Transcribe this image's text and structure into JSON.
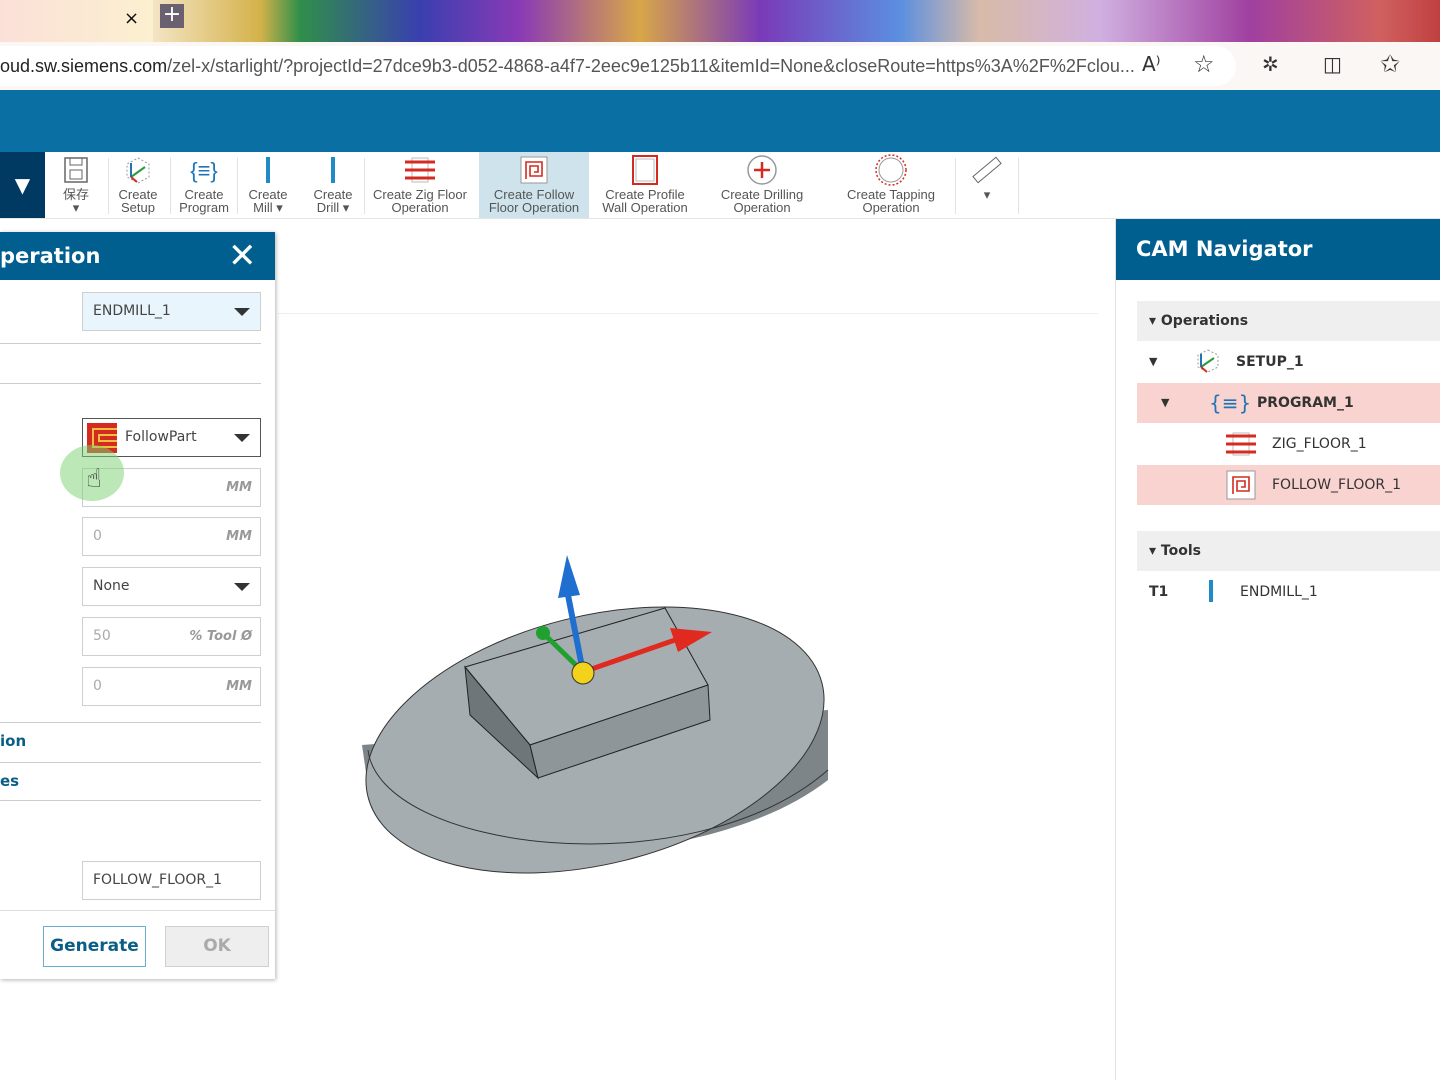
{
  "browser": {
    "tab_close": "×",
    "new_tab": "+",
    "url_domain": "oud.sw.siemens.com",
    "url_rest": "/zel-x/starlight/?projectId=27dce9b3-d052-4868-a4f7-2eec9e125b11&itemId=None&closeRoute=https%3A%2F%2Fclou...",
    "read_aloud": "A⁾",
    "favorite": "☆",
    "extensions": "✲",
    "split": "◫",
    "favorites": "✩"
  },
  "toolbar": {
    "save": "保存",
    "items": [
      {
        "label1": "Create",
        "label2": "Setup"
      },
      {
        "label1": "Create",
        "label2": "Program"
      },
      {
        "label1": "Create",
        "label2": "Mill ▾"
      },
      {
        "label1": "Create",
        "label2": "Drill ▾"
      },
      {
        "label1": "Create Zig Floor",
        "label2": "Operation"
      },
      {
        "label1": "Create Follow",
        "label2": "Floor Operation"
      },
      {
        "label1": "Create Profile",
        "label2": "Wall Operation"
      },
      {
        "label1": "Create Drilling",
        "label2": "Operation"
      },
      {
        "label1": "Create Tapping",
        "label2": "Operation"
      }
    ],
    "active_index": 5
  },
  "dialog": {
    "title": "peration",
    "tool": "ENDMILL_1",
    "pattern": "FollowPart",
    "f1_unit": "MM",
    "f2_value": "0",
    "f2_unit": "MM",
    "f3": "None",
    "f4_value": "50",
    "f4_unit": "% Tool Ø",
    "f5_value": "0",
    "f5_unit": "MM",
    "section1": "ion",
    "section2": "es",
    "name": "FOLLOW_FLOOR_1",
    "generate": "Generate",
    "ok": "OK"
  },
  "navigator": {
    "title": "CAM Navigator",
    "operations_label": "▾ Operations",
    "setup": "SETUP_1",
    "program": "PROGRAM_1",
    "op1": "ZIG_FLOOR_1",
    "op2": "FOLLOW_FLOOR_1",
    "tools_label": "▾ Tools",
    "tool_num": "T1",
    "tool_name": "ENDMILL_1"
  },
  "colors": {
    "header_blue": "#0a6fa3",
    "dialog_blue": "#005f8f",
    "selection": "#f9d3cf",
    "accent_red": "#d42a1f"
  }
}
